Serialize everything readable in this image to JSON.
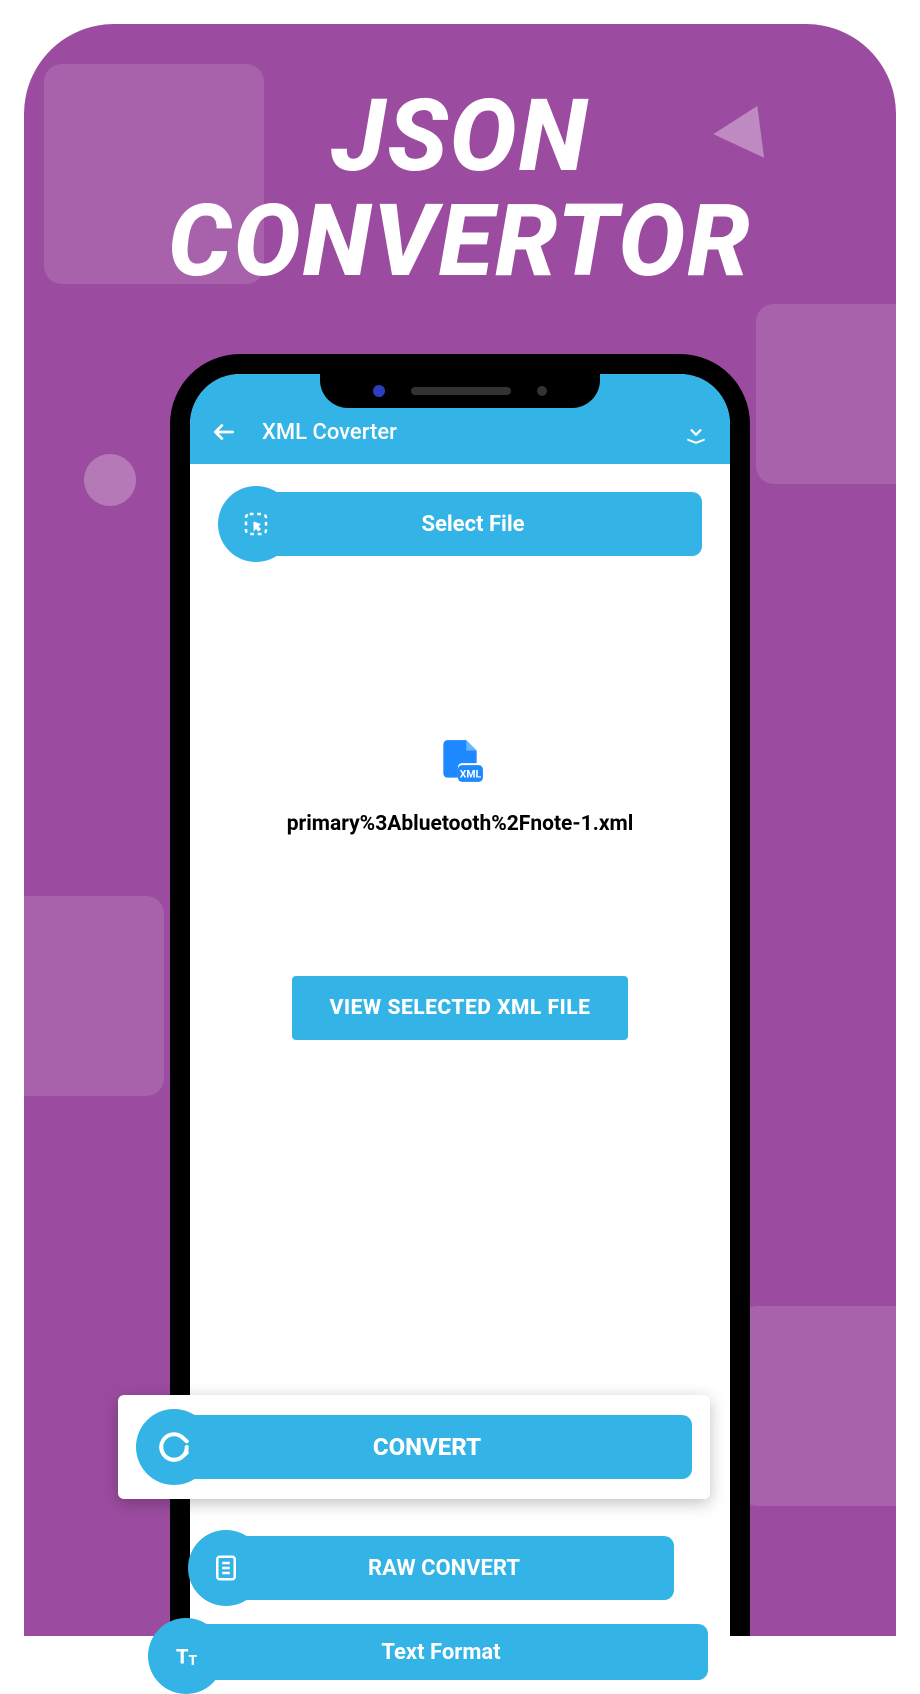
{
  "promo": {
    "title_line1": "JSON",
    "title_line2": "CONVERTOR"
  },
  "appbar": {
    "title": "XML Coverter"
  },
  "select_file_label": "Select File",
  "selected_file_name": "primary%3Abluetooth%2Fnote-1.xml",
  "file_badge": "XML",
  "view_button_label": "VIEW SELECTED XML FILE",
  "convert_label": "CONVERT",
  "raw_convert_label": "RAW CONVERT",
  "text_format_label": "Text Format"
}
